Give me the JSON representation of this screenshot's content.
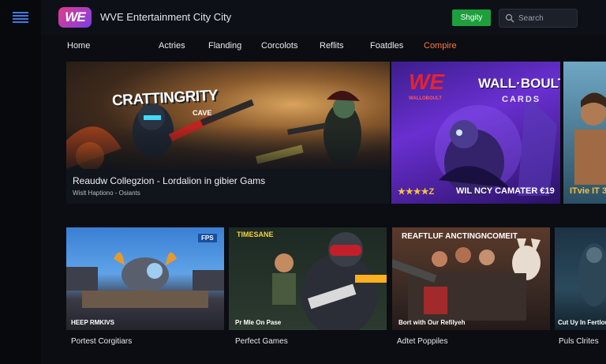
{
  "header": {
    "logo_text": "WE",
    "title": "WVE Entertainment City City",
    "signup_label": "Shgity",
    "search_placeholder": "Search"
  },
  "nav": {
    "tabs": [
      {
        "label": "Home",
        "active": false
      },
      {
        "label": "Actries",
        "active": false
      },
      {
        "label": "Flanding",
        "active": false
      },
      {
        "label": "Corcolots",
        "active": false
      },
      {
        "label": "Reflits",
        "active": false
      },
      {
        "label": "Foatdles",
        "active": false
      },
      {
        "label": "Compire",
        "active": true
      }
    ]
  },
  "featured": {
    "hero": {
      "logo_text": "CRATTINGRITY",
      "logo_sub": "CAVE",
      "title": "Reaudw Collegzion - Lordalion in gibier Gams",
      "subtitle": "Wislt Haptiono - Osiants"
    },
    "promo": {
      "badge": "WE",
      "badge_sub": "WALLOBOULT",
      "heading_line1": "WALL·BOULT",
      "heading_line2": "CARDS",
      "stars": "★★★★Z",
      "caption": "WIL NCY CAMATER €19"
    },
    "peek": {
      "caption": "ITvie IT 3"
    }
  },
  "row": [
    {
      "overlay": "HEEP RMKIVS",
      "tag": "FPS",
      "label": "Portest Corgitiars"
    },
    {
      "overlay": "Pr Mle On Pase",
      "tag": "TIMESANE",
      "label": "Perfect Games"
    },
    {
      "overlay": "Bort with Our Refilyeh",
      "tag": "REAFTLUF ANCTINGNCOMEIT",
      "label": "Adtet Poppiles"
    },
    {
      "overlay": "Cut Uy In Fertlow",
      "tag": "",
      "label": "Puls Clrites"
    }
  ],
  "colors": {
    "accent_orange": "#ff7a35",
    "signup_green": "#1d9f3e",
    "menu_blue": "#3d7be0"
  }
}
